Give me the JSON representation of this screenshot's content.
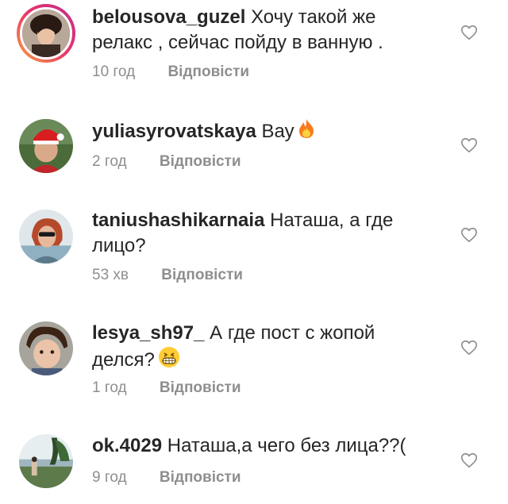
{
  "comments": [
    {
      "username": "belousova_guzel",
      "text": "Хочу такой же релакс , сейчас пойду в ванную .",
      "time": "10 год",
      "reply_label": "Відповісти",
      "has_story_ring": true,
      "emoji": ""
    },
    {
      "username": "yuliasyrovatskaya",
      "text": "Вау",
      "time": "2 год",
      "reply_label": "Відповісти",
      "has_story_ring": false,
      "emoji": "fire-emoji"
    },
    {
      "username": "taniushashikarnaia",
      "text": "Наташа, а где лицо?",
      "time": "53 хв",
      "reply_label": "Відповісти",
      "has_story_ring": false,
      "emoji": ""
    },
    {
      "username": "lesya_sh97_",
      "text": "А где пост с жопой делся?",
      "time": "1 год",
      "reply_label": "Відповісти",
      "has_story_ring": false,
      "emoji": "grinning-emoji"
    },
    {
      "username": "ok.4029",
      "text": "Наташа,а чего без лица??(",
      "time": "9 год",
      "reply_label": "Відповісти",
      "has_story_ring": false,
      "emoji": ""
    }
  ],
  "colors": {
    "text": "#262626",
    "meta": "#8e8e8e",
    "heart_outline": "#8e8e8e",
    "story_ring_start": "#f9a73e",
    "story_ring_end": "#c02f8c"
  }
}
